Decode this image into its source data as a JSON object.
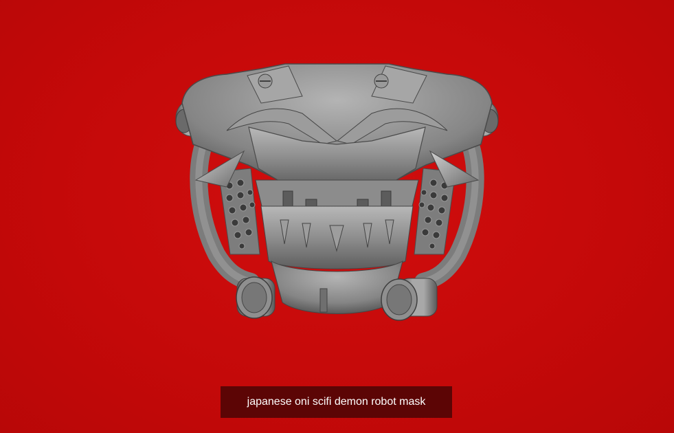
{
  "viewport": {
    "background_color": "#c80a0a",
    "model_color": "#8a8a8a"
  },
  "model": {
    "icon": "oni-robot-mask-3d-render"
  },
  "caption": {
    "text": "japanese oni scifi demon robot mask",
    "background_color": "#5c0505",
    "text_color": "#ffffff"
  }
}
